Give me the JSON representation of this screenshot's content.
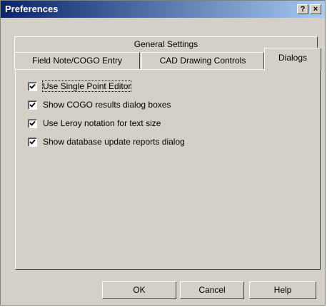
{
  "window": {
    "title": "Preferences"
  },
  "titlebar_buttons": {
    "help": "?",
    "close": "×"
  },
  "tabs": {
    "back_row": [
      "General Settings"
    ],
    "front_row": [
      "Field Note/COGO Entry",
      "CAD Drawing Controls",
      "Dialogs"
    ],
    "active": "Dialogs"
  },
  "options": [
    {
      "label": "Use Single Point Editor",
      "checked": true
    },
    {
      "label": "Show COGO results dialog boxes",
      "checked": true
    },
    {
      "label": "Use Leroy notation for text size",
      "checked": true
    },
    {
      "label": "Show database update reports dialog",
      "checked": true
    }
  ],
  "buttons": {
    "ok": "OK",
    "cancel": "Cancel",
    "help": "Help"
  }
}
